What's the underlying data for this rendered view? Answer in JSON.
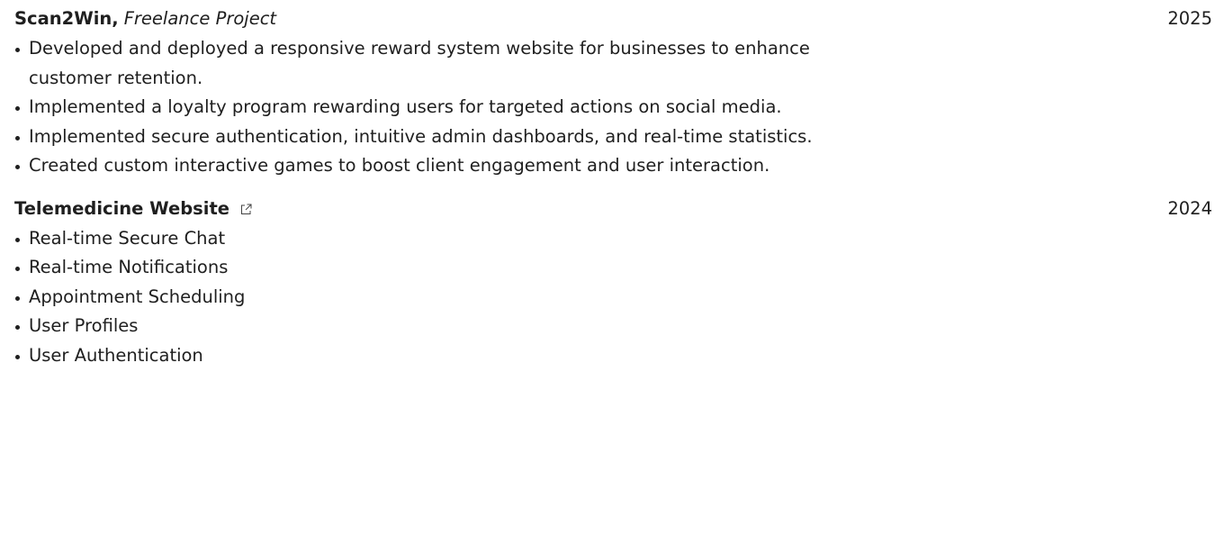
{
  "projects": [
    {
      "name": "Scan2Win,",
      "role": "Freelance Project",
      "year": "2025",
      "has_link": false,
      "bullets": [
        "Developed and deployed a responsive reward system website for businesses to enhance customer retention.",
        "Implemented a loyalty program rewarding users for targeted actions on social media.",
        "Implemented secure authentication, intuitive admin dashboards, and real-time statistics.",
        "Created custom interactive games to boost client engagement and user interaction."
      ]
    },
    {
      "name": "Telemedicine Website",
      "role": "",
      "year": "2024",
      "has_link": true,
      "link_icon": "external-link-icon",
      "bullets": [
        "Real-time Secure Chat",
        "Real-time Notifications",
        "Appointment Scheduling",
        "User Profiles",
        "User Authentication"
      ]
    }
  ]
}
